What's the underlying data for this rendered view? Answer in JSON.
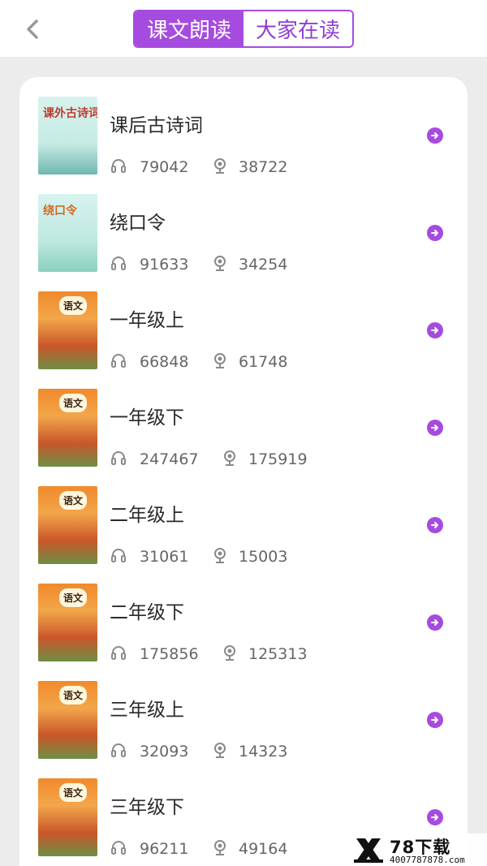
{
  "header": {
    "tabs": [
      {
        "label": "课文朗读",
        "active": true
      },
      {
        "label": "大家在读",
        "active": false
      }
    ]
  },
  "colors": {
    "accent": "#a64bdf",
    "page_bg": "#ececec",
    "card_bg": "#ffffff",
    "text": "#2a2a2a",
    "muted": "#666666"
  },
  "icons": {
    "back": "chevron-left-icon",
    "listen": "headphones-icon",
    "record": "microphone-icon",
    "go": "arrow-right-circle-icon"
  },
  "books": [
    {
      "title": "课后古诗词",
      "listens": "79042",
      "reads": "38722",
      "cover_label": "课外古诗词"
    },
    {
      "title": "绕口令",
      "listens": "91633",
      "reads": "34254",
      "cover_label": "绕口令"
    },
    {
      "title": "一年级上",
      "listens": "66848",
      "reads": "61748",
      "cover_label": "语文"
    },
    {
      "title": "一年级下",
      "listens": "247467",
      "reads": "175919",
      "cover_label": "语文"
    },
    {
      "title": "二年级上",
      "listens": "31061",
      "reads": "15003",
      "cover_label": "语文"
    },
    {
      "title": "二年级下",
      "listens": "175856",
      "reads": "125313",
      "cover_label": "语文"
    },
    {
      "title": "三年级上",
      "listens": "32093",
      "reads": "14323",
      "cover_label": "语文"
    },
    {
      "title": "三年级下",
      "listens": "96211",
      "reads": "49164",
      "cover_label": "语文"
    }
  ],
  "watermark": {
    "brand": "78下载",
    "url": "4007787878.com"
  }
}
